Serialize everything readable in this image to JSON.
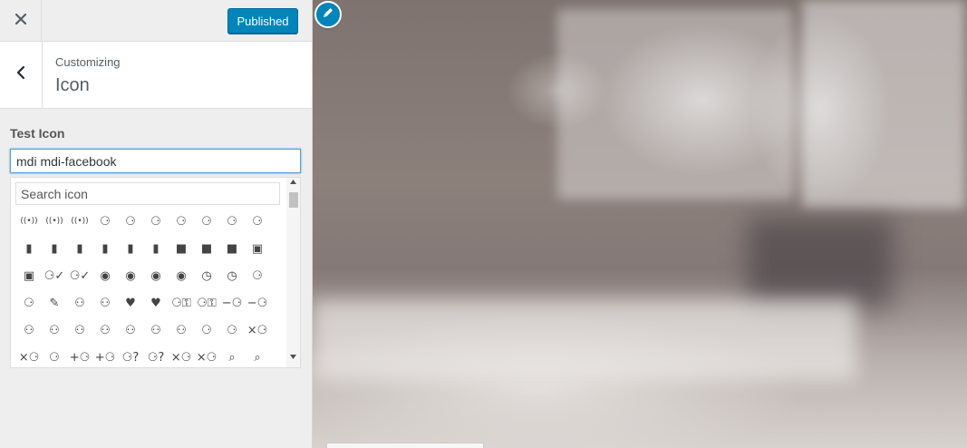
{
  "header": {
    "close_icon": "close-icon",
    "publish_label": "Published"
  },
  "section": {
    "back_icon": "chevron-left-icon",
    "breadcrumb": "Customizing",
    "title": "Icon"
  },
  "control": {
    "label": "Test Icon",
    "value": "mdi mdi-facebook",
    "search_placeholder": "Search icon"
  },
  "icons": [
    "access-point",
    "access-point-network",
    "access-point-network-off",
    "account",
    "account-alert",
    "account-alert-outline",
    "account-arrow-left",
    "account-arrow-left-outline",
    "account-arrow-right",
    "account-arrow-right-outline",
    "account-badge",
    "account-badge-alert",
    "account-badge-alert-outline",
    "account-badge-horizontal",
    "account-badge-horizontal-outline",
    "account-badge-outline",
    "account-box",
    "account-box-multiple",
    "account-box-outline",
    "account-card-details",
    "account-card-details-outline",
    "account-check",
    "account-check-outline",
    "account-child",
    "account-child-circle",
    "account-circle",
    "account-circle-outline",
    "account-clock",
    "account-clock-outline",
    "account-convert",
    "account-details",
    "account-edit",
    "account-group",
    "account-group-outline",
    "account-heart",
    "account-heart-outline",
    "account-key",
    "account-key-outline",
    "account-minus",
    "account-minus-outline",
    "account-multiple",
    "account-multiple-check",
    "account-multiple-minus",
    "account-multiple-minus-outline",
    "account-multiple-outline",
    "account-multiple-plus",
    "account-multiple-plus-outline",
    "account-network",
    "account-network-outline",
    "account-off",
    "account-off-outline",
    "account-outline",
    "account-plus",
    "account-plus-outline",
    "account-question",
    "account-question-outline",
    "account-remove",
    "account-remove-outline",
    "account-search",
    "account-search-outline"
  ],
  "colors": {
    "accent": "#0085ba",
    "sidebar_bg": "#eeeeee",
    "input_focus": "#5b9dd9"
  },
  "preview": {
    "edit_icon": "pencil-icon"
  }
}
